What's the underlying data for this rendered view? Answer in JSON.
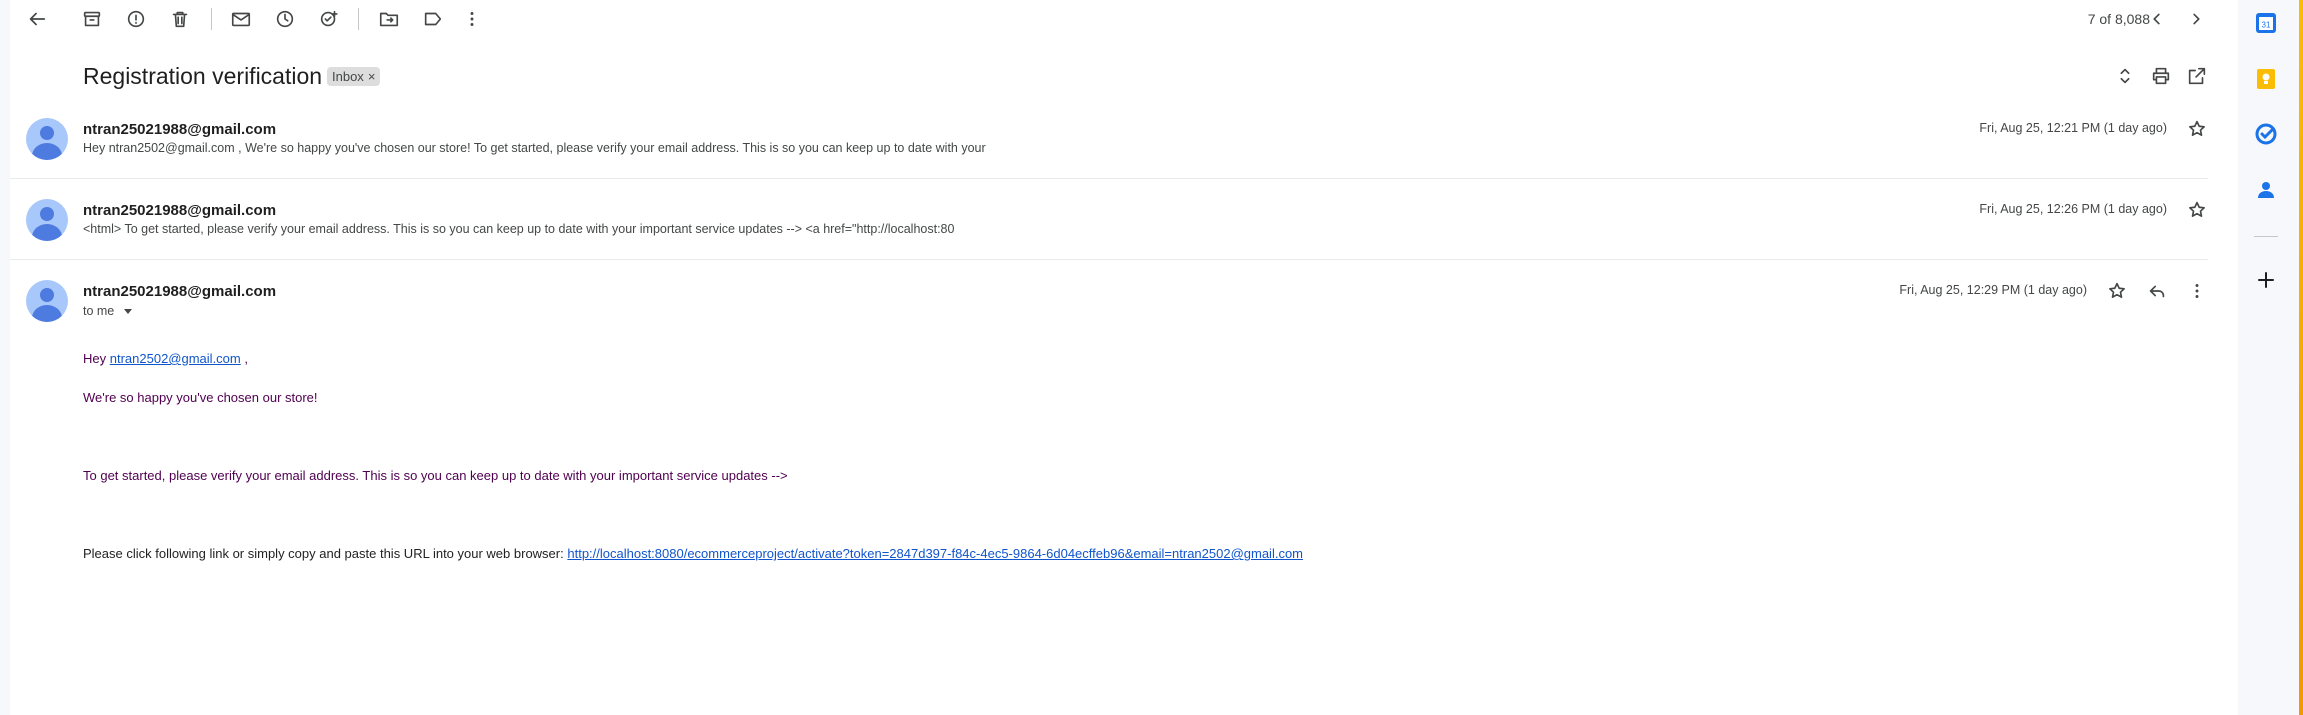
{
  "toolbar": {
    "counter": "7 of 8,088"
  },
  "thread": {
    "subject": "Registration verification",
    "label": "Inbox",
    "label_remove": "×"
  },
  "messages": [
    {
      "sender": "ntran25021988@gmail.com",
      "snippet": "Hey ntran2502@gmail.com , We're so happy you've chosen our store! To get started, please verify your email address. This is so you can keep up to date with your",
      "date": "Fri, Aug 25, 12:21 PM (1 day ago)"
    },
    {
      "sender": "ntran25021988@gmail.com",
      "snippet": "<html> To get started, please verify your email address. This is so you can keep up to date with your important service updates --> <a href=\"http://localhost:80",
      "date": "Fri, Aug 25, 12:26 PM (1 day ago)"
    },
    {
      "sender": "ntran25021988@gmail.com",
      "recipient": "to me",
      "date": "Fri, Aug 25, 12:29 PM (1 day ago)"
    }
  ],
  "email_body": {
    "greeting_prefix": "Hey",
    "greeting_email": "ntran2502@gmail.com",
    "greeting_suffix": ",",
    "line1": "We're so happy you've chosen our store!",
    "line2": "To get started, please verify your email address. This is so you can keep up to date with your important service updates -->",
    "line3_prefix": "Please click following link or simply copy and paste this URL into your web browser:",
    "activation_link": "http://localhost:8080/ecommerceproject/activate?token=2847d397-f84c-4ec5-9864-6d04ecffeb96&email=ntran2502@gmail.com"
  },
  "sidebar_apps": {
    "calendar_day": "31"
  },
  "colors": {
    "link": "#1155cc",
    "quoted_purple": "#500050",
    "avatar_bg": "#a8c7fa",
    "avatar_fg": "#4d7be0"
  }
}
